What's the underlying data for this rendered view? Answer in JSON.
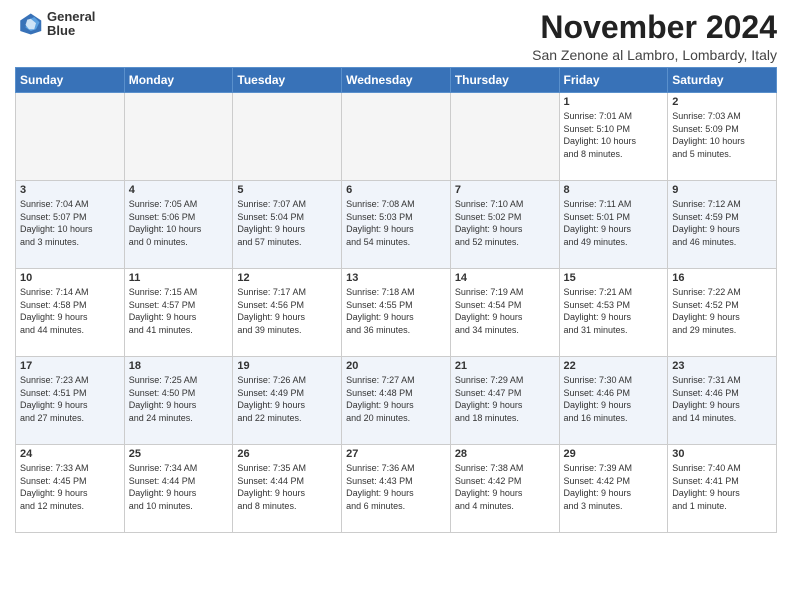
{
  "logo": {
    "line1": "General",
    "line2": "Blue"
  },
  "title": "November 2024",
  "location": "San Zenone al Lambro, Lombardy, Italy",
  "days_of_week": [
    "Sunday",
    "Monday",
    "Tuesday",
    "Wednesday",
    "Thursday",
    "Friday",
    "Saturday"
  ],
  "weeks": [
    [
      {
        "day": "",
        "info": ""
      },
      {
        "day": "",
        "info": ""
      },
      {
        "day": "",
        "info": ""
      },
      {
        "day": "",
        "info": ""
      },
      {
        "day": "",
        "info": ""
      },
      {
        "day": "1",
        "info": "Sunrise: 7:01 AM\nSunset: 5:10 PM\nDaylight: 10 hours\nand 8 minutes."
      },
      {
        "day": "2",
        "info": "Sunrise: 7:03 AM\nSunset: 5:09 PM\nDaylight: 10 hours\nand 5 minutes."
      }
    ],
    [
      {
        "day": "3",
        "info": "Sunrise: 7:04 AM\nSunset: 5:07 PM\nDaylight: 10 hours\nand 3 minutes."
      },
      {
        "day": "4",
        "info": "Sunrise: 7:05 AM\nSunset: 5:06 PM\nDaylight: 10 hours\nand 0 minutes."
      },
      {
        "day": "5",
        "info": "Sunrise: 7:07 AM\nSunset: 5:04 PM\nDaylight: 9 hours\nand 57 minutes."
      },
      {
        "day": "6",
        "info": "Sunrise: 7:08 AM\nSunset: 5:03 PM\nDaylight: 9 hours\nand 54 minutes."
      },
      {
        "day": "7",
        "info": "Sunrise: 7:10 AM\nSunset: 5:02 PM\nDaylight: 9 hours\nand 52 minutes."
      },
      {
        "day": "8",
        "info": "Sunrise: 7:11 AM\nSunset: 5:01 PM\nDaylight: 9 hours\nand 49 minutes."
      },
      {
        "day": "9",
        "info": "Sunrise: 7:12 AM\nSunset: 4:59 PM\nDaylight: 9 hours\nand 46 minutes."
      }
    ],
    [
      {
        "day": "10",
        "info": "Sunrise: 7:14 AM\nSunset: 4:58 PM\nDaylight: 9 hours\nand 44 minutes."
      },
      {
        "day": "11",
        "info": "Sunrise: 7:15 AM\nSunset: 4:57 PM\nDaylight: 9 hours\nand 41 minutes."
      },
      {
        "day": "12",
        "info": "Sunrise: 7:17 AM\nSunset: 4:56 PM\nDaylight: 9 hours\nand 39 minutes."
      },
      {
        "day": "13",
        "info": "Sunrise: 7:18 AM\nSunset: 4:55 PM\nDaylight: 9 hours\nand 36 minutes."
      },
      {
        "day": "14",
        "info": "Sunrise: 7:19 AM\nSunset: 4:54 PM\nDaylight: 9 hours\nand 34 minutes."
      },
      {
        "day": "15",
        "info": "Sunrise: 7:21 AM\nSunset: 4:53 PM\nDaylight: 9 hours\nand 31 minutes."
      },
      {
        "day": "16",
        "info": "Sunrise: 7:22 AM\nSunset: 4:52 PM\nDaylight: 9 hours\nand 29 minutes."
      }
    ],
    [
      {
        "day": "17",
        "info": "Sunrise: 7:23 AM\nSunset: 4:51 PM\nDaylight: 9 hours\nand 27 minutes."
      },
      {
        "day": "18",
        "info": "Sunrise: 7:25 AM\nSunset: 4:50 PM\nDaylight: 9 hours\nand 24 minutes."
      },
      {
        "day": "19",
        "info": "Sunrise: 7:26 AM\nSunset: 4:49 PM\nDaylight: 9 hours\nand 22 minutes."
      },
      {
        "day": "20",
        "info": "Sunrise: 7:27 AM\nSunset: 4:48 PM\nDaylight: 9 hours\nand 20 minutes."
      },
      {
        "day": "21",
        "info": "Sunrise: 7:29 AM\nSunset: 4:47 PM\nDaylight: 9 hours\nand 18 minutes."
      },
      {
        "day": "22",
        "info": "Sunrise: 7:30 AM\nSunset: 4:46 PM\nDaylight: 9 hours\nand 16 minutes."
      },
      {
        "day": "23",
        "info": "Sunrise: 7:31 AM\nSunset: 4:46 PM\nDaylight: 9 hours\nand 14 minutes."
      }
    ],
    [
      {
        "day": "24",
        "info": "Sunrise: 7:33 AM\nSunset: 4:45 PM\nDaylight: 9 hours\nand 12 minutes."
      },
      {
        "day": "25",
        "info": "Sunrise: 7:34 AM\nSunset: 4:44 PM\nDaylight: 9 hours\nand 10 minutes."
      },
      {
        "day": "26",
        "info": "Sunrise: 7:35 AM\nSunset: 4:44 PM\nDaylight: 9 hours\nand 8 minutes."
      },
      {
        "day": "27",
        "info": "Sunrise: 7:36 AM\nSunset: 4:43 PM\nDaylight: 9 hours\nand 6 minutes."
      },
      {
        "day": "28",
        "info": "Sunrise: 7:38 AM\nSunset: 4:42 PM\nDaylight: 9 hours\nand 4 minutes."
      },
      {
        "day": "29",
        "info": "Sunrise: 7:39 AM\nSunset: 4:42 PM\nDaylight: 9 hours\nand 3 minutes."
      },
      {
        "day": "30",
        "info": "Sunrise: 7:40 AM\nSunset: 4:41 PM\nDaylight: 9 hours\nand 1 minute."
      }
    ]
  ]
}
